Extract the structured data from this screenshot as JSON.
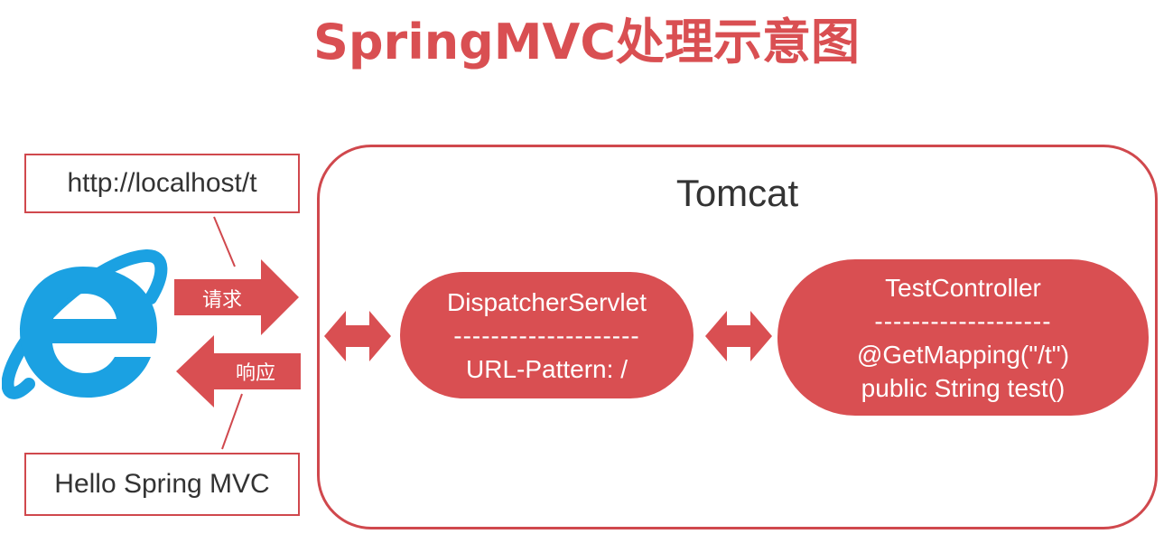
{
  "title": "SpringMVC处理示意图",
  "client": {
    "url": "http://localhost/t",
    "response_text": "Hello Spring MVC",
    "browser_icon": "internet-explorer-icon"
  },
  "arrows": {
    "request_label": "请求",
    "response_label": "响应"
  },
  "tomcat": {
    "label": "Tomcat",
    "dispatcher": {
      "name": "DispatcherServlet",
      "divider": "--------------------",
      "pattern": "URL-Pattern: /"
    },
    "controller": {
      "name": "TestController",
      "divider": "-------------------",
      "mapping": "@GetMapping(\"/t\")",
      "method": "public String test()"
    }
  },
  "colors": {
    "accent": "#d94f52",
    "border": "#d0484d",
    "ie_blue": "#1ba1e2"
  }
}
